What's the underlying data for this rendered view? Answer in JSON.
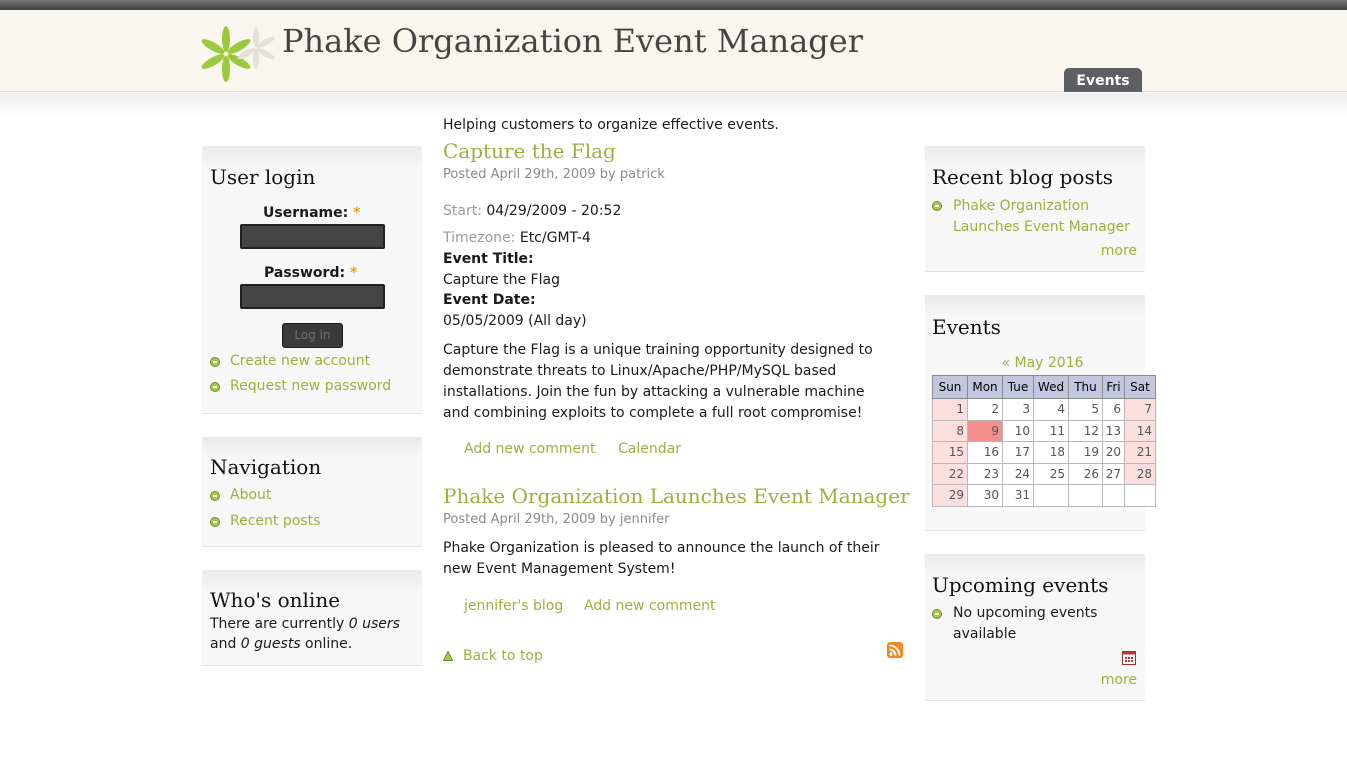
{
  "site": {
    "name": "Phake Organization Event Manager",
    "primary_tab": "Events"
  },
  "mission": "Helping customers to organize effective events.",
  "user_login": {
    "title": "User login",
    "username_label": "Username:",
    "password_label": "Password:",
    "required_mark": "*",
    "login_button": "Log in",
    "links": [
      "Create new account",
      "Request new password"
    ]
  },
  "navigation": {
    "title": "Navigation",
    "links": [
      "About",
      "Recent posts"
    ]
  },
  "whos_online": {
    "title": "Who's online",
    "line1_prefix": "There are currently ",
    "users": "0 users",
    "line2_prefix": "and ",
    "guests": "0 guests",
    "line2_suffix": " online."
  },
  "nodes": [
    {
      "title": "Capture the Flag",
      "submitted": "Posted April 29th, 2009 by patrick",
      "start_label": "Start:",
      "start_value": "04/29/2009 - 20:52",
      "timezone_label": "Timezone:",
      "timezone_value": "Etc/GMT-4",
      "event_title_label": "Event Title:",
      "event_title_value": "Capture the Flag",
      "event_date_label": "Event Date:",
      "event_date_value": "05/05/2009 (All day)",
      "body": "Capture the Flag is a unique training opportunity designed to demonstrate threats to Linux/Apache/PHP/MySQL based installations. Join the fun by attacking a vulnerable machine and combining exploits to complete a full root compromise!",
      "links": [
        "Add new comment",
        "Calendar"
      ]
    },
    {
      "title": "Phake Organization Launches Event Manager",
      "submitted": "Posted April 29th, 2009 by jennifer",
      "body": "Phake Organization is pleased to announce the launch of their new Event Management System!",
      "links": [
        "jennifer's blog",
        "Add new comment"
      ]
    }
  ],
  "back_to_top": "Back to top",
  "recent_blog_posts": {
    "title": "Recent blog posts",
    "items": [
      "Phake Organization Launches Event Manager"
    ],
    "more": "more"
  },
  "events_block": {
    "title": "Events",
    "caption": "« May 2016",
    "weekdays": [
      "Sun",
      "Mon",
      "Tue",
      "Wed",
      "Thu",
      "Fri",
      "Sat"
    ],
    "weeks": [
      [
        "1",
        "2",
        "3",
        "4",
        "5",
        "6",
        "7"
      ],
      [
        "8",
        "9",
        "10",
        "11",
        "12",
        "13",
        "14"
      ],
      [
        "15",
        "16",
        "17",
        "18",
        "19",
        "20",
        "21"
      ],
      [
        "22",
        "23",
        "24",
        "25",
        "26",
        "27",
        "28"
      ],
      [
        "29",
        "30",
        "31",
        "",
        "",
        "",
        ""
      ]
    ],
    "today": "9"
  },
  "upcoming_events": {
    "title": "Upcoming events",
    "items": [
      "No upcoming events available"
    ],
    "more": "more"
  },
  "colors": {
    "link": "#98b33d",
    "tab_bg": "#5d5f63",
    "calendar_header": "#c3c6df",
    "calendar_weekend": "#fcdede",
    "calendar_today": "#f58f8f"
  }
}
